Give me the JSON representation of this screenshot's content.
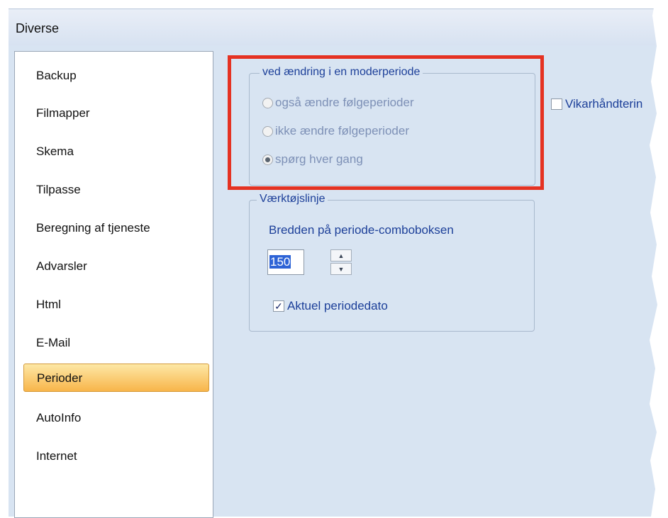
{
  "window": {
    "title": "Diverse"
  },
  "sidebar": {
    "items": [
      {
        "label": "Backup"
      },
      {
        "label": "Filmapper"
      },
      {
        "label": "Skema"
      },
      {
        "label": "Tilpasse"
      },
      {
        "label": "Beregning af tjeneste"
      },
      {
        "label": "Advarsler"
      },
      {
        "label": "Html"
      },
      {
        "label": "E-Mail"
      },
      {
        "label": "Perioder",
        "selected": true
      },
      {
        "label": "AutoInfo"
      },
      {
        "label": "Internet"
      }
    ]
  },
  "moder_group": {
    "legend": "ved ændring i en moderperiode",
    "options": [
      {
        "label": "også ændre følgeperioder",
        "selected": false
      },
      {
        "label": "ikke ændre følgeperioder",
        "selected": false
      },
      {
        "label": "spørg hver gang",
        "selected": true
      }
    ]
  },
  "vikar": {
    "label": "Vikarhåndterin",
    "checked": false
  },
  "toolbar_group": {
    "legend": "Værktøjslinje",
    "width_label": "Bredden på periode-comboboksen",
    "width_value": "150",
    "current_date_label": "Aktuel periodedato",
    "current_date_checked": true
  },
  "colors": {
    "highlight": "#e53222",
    "selected_item": "#f8b54a",
    "label_text": "#1c3f99",
    "panel_background": "#d8e4f2"
  },
  "icons": [
    "spin-up-icon",
    "spin-down-icon",
    "checkmark-icon",
    "radio-dot-icon"
  ]
}
